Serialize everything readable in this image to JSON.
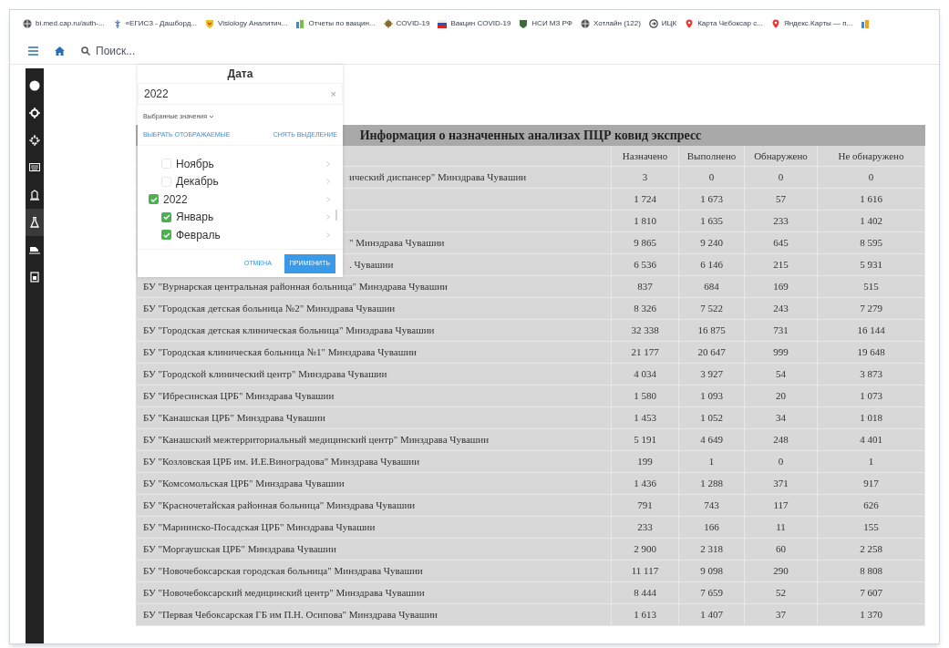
{
  "bookmarks": [
    {
      "label": "bi.med.cap.ru/auth-..."
    },
    {
      "label": "«ЕГИСЗ - Дашборд..."
    },
    {
      "label": "Visiology Аналитич..."
    },
    {
      "label": "Отчеты по вакцин..."
    },
    {
      "label": "COVID-19"
    },
    {
      "label": "Вакцин COVID-19"
    },
    {
      "label": "НСИ МЗ РФ"
    },
    {
      "label": "Хотлайн (122)"
    },
    {
      "label": "ИЦК"
    },
    {
      "label": "Карта Чебоксар с..."
    },
    {
      "label": "Яндекс.Карты — п..."
    },
    {
      "kind": "icon"
    }
  ],
  "navbar": {
    "search_placeholder": "Поиск..."
  },
  "sidebar": {
    "items": [
      {
        "selected": false
      },
      {
        "selected": false
      },
      {
        "selected": false
      },
      {
        "selected": false
      },
      {
        "selected": false
      },
      {
        "selected": true
      },
      {
        "selected": false
      },
      {
        "selected": false
      }
    ]
  },
  "filter": {
    "title": "Дата",
    "value": "2022",
    "clear_icon": "×",
    "selected_values": "Выбранные значения",
    "select_shown": "ВЫБРАТЬ ОТОБРАЖАЕМЫЕ",
    "clear_selection": "СНЯТЬ ВЫДЕЛЕНИЕ",
    "tree": [
      {
        "children": [
          {
            "label": "Ноябрь",
            "checked": false
          },
          {
            "label": "Декабрь",
            "checked": false
          }
        ]
      },
      {
        "label": "2022",
        "checked": true,
        "children": [
          {
            "label": "Январь",
            "checked": true
          },
          {
            "label": "Февраль",
            "checked": true
          }
        ]
      }
    ],
    "cancel": "ОТМЕНА",
    "apply": "ПРИМЕНИТЬ"
  },
  "table": {
    "title": "Информация о назначенных анализах ПЦР ковид экспресс",
    "columns": [
      "",
      "Назначено",
      "Выполнено",
      "Обнаружено",
      "Не обнаружено"
    ],
    "rows": [
      [
        "ический диспансер\" Минздрава Чувашии",
        "3",
        "0",
        "0",
        "0"
      ],
      [
        "",
        "1 724",
        "1 673",
        "57",
        "1 616"
      ],
      [
        "",
        "1 810",
        "1 635",
        "233",
        "1 402"
      ],
      [
        "\" Минздрава Чувашии",
        "9 865",
        "9 240",
        "645",
        "8 595"
      ],
      [
        ". Чувашии",
        "6 536",
        "6 146",
        "215",
        "5 931"
      ],
      [
        "БУ \"Вурнарская центральная районная больница\" Минздрава Чувашии",
        "837",
        "684",
        "169",
        "515"
      ],
      [
        "БУ \"Городская детская больница №2\" Минздрава Чувашии",
        "8 326",
        "7 522",
        "243",
        "7 279"
      ],
      [
        "БУ \"Городская детская клиническая больница\" Минздрава Чувашии",
        "32 338",
        "16 875",
        "731",
        "16 144"
      ],
      [
        "БУ \"Городская клиническая больница №1\" Минздрава Чувашии",
        "21 177",
        "20 647",
        "999",
        "19 648"
      ],
      [
        "БУ \"Городской клинический центр\" Минздрава Чувашии",
        "4 034",
        "3 927",
        "54",
        "3 873"
      ],
      [
        "БУ \"Ибресинская ЦРБ\" Минздрава Чувашии",
        "1 580",
        "1 093",
        "20",
        "1 073"
      ],
      [
        "БУ \"Канашская ЦРБ\" Минздрава Чувашии",
        "1 453",
        "1 052",
        "34",
        "1 018"
      ],
      [
        "БУ \"Канашский межтерриториальный медицинский центр\" Минздрава Чувашии",
        "5 191",
        "4 649",
        "248",
        "4 401"
      ],
      [
        "БУ \"Козловская ЦРБ им. И.Е.Виноградова\" Минздрава Чувашии",
        "199",
        "1",
        "0",
        "1"
      ],
      [
        "БУ \"Комсомольская ЦРБ\" Минздрава Чувашии",
        "1 436",
        "1 288",
        "371",
        "917"
      ],
      [
        "БУ \"Красночетайская районная больница\" Минздрава Чувашии",
        "791",
        "743",
        "117",
        "626"
      ],
      [
        "БУ \"Мариинско-Посадская ЦРБ\" Минздрава Чувашии",
        "233",
        "166",
        "11",
        "155"
      ],
      [
        "БУ \"Моргаушская ЦРБ\" Минздрава Чувашии",
        "2 900",
        "2 318",
        "60",
        "2 258"
      ],
      [
        "БУ \"Новочебоксарская городская больница\" Минздрава Чувашии",
        "11 117",
        "9 098",
        "290",
        "8 808"
      ],
      [
        "БУ \"Новочебоксарский медицинский центр\" Минздрава Чувашии",
        "8 444",
        "7 659",
        "52",
        "7 607"
      ],
      [
        "БУ \"Первая Чебоксарская ГБ им П.Н. Осипова\" Минздрава Чувашии",
        "1 613",
        "1 407",
        "37",
        "1 370"
      ]
    ]
  }
}
